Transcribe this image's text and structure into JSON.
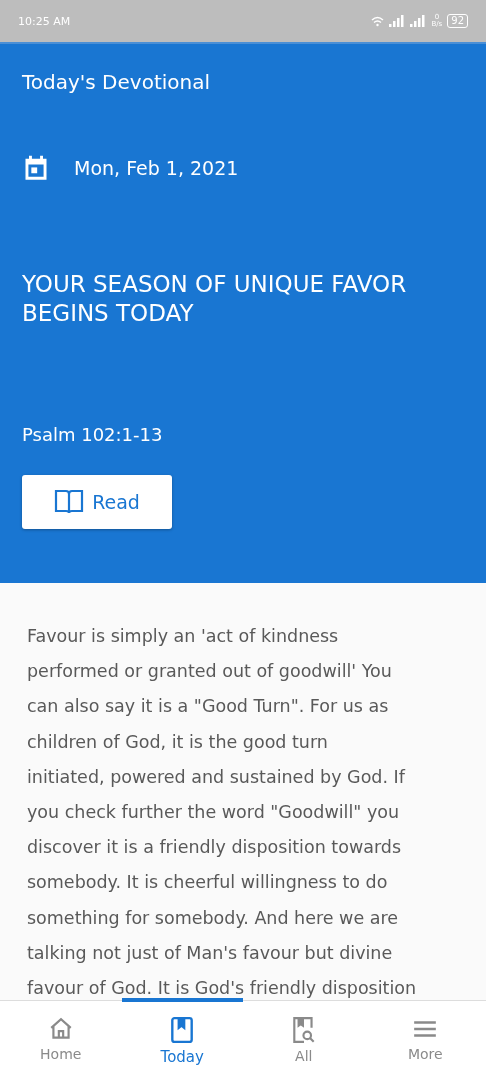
{
  "status_bar": {
    "time": "10:25 AM",
    "speed_value": "0",
    "speed_unit": "B/s",
    "battery": "92"
  },
  "header": {
    "title": "Today's Devotional",
    "date": "Mon, Feb 1, 2021",
    "headline": "YOUR SEASON OF UNIQUE FAVOR BEGINS TODAY",
    "scripture": "Psalm 102:1-13",
    "read_button": "Read"
  },
  "body_lines": [
    "Favour is simply an 'act of kindness",
    "performed or granted out of goodwill' You",
    "can also say it is a \"Good Turn\". For us as",
    "children of God, it is the  good turn",
    "initiated, powered and sustained by God. If",
    "you check further the word \"Goodwill\" you",
    "discover it is a friendly disposition towards",
    "somebody. It is cheerful willingness to do",
    "something for somebody. And here we are",
    "talking not just of Man's favour but divine",
    "favour of God. It is God's friendly disposition"
  ],
  "nav": [
    {
      "kind": "home",
      "label": "Home",
      "selected": false
    },
    {
      "kind": "today",
      "label": "Today",
      "selected": true
    },
    {
      "kind": "all",
      "label": "All",
      "selected": false
    },
    {
      "kind": "more",
      "label": "More",
      "selected": false
    }
  ]
}
